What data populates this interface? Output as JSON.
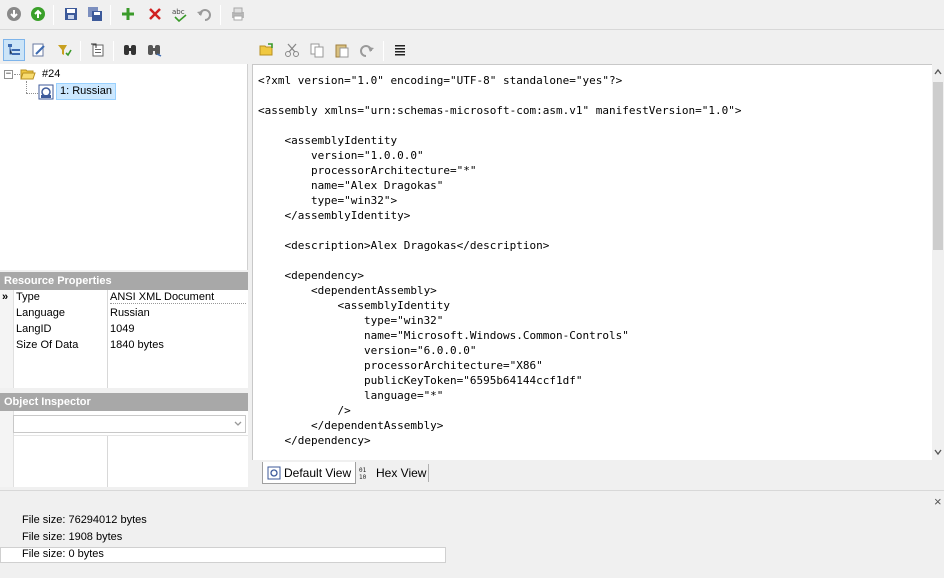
{
  "tree": {
    "root_label": "#24",
    "child_label": "1: Russian"
  },
  "resource_properties": {
    "header": "Resource Properties",
    "rows": [
      {
        "key": "Type",
        "value": "ANSI XML Document"
      },
      {
        "key": "Language",
        "value": "Russian"
      },
      {
        "key": "LangID",
        "value": "1049"
      },
      {
        "key": "Size Of Data",
        "value": "1840 bytes"
      }
    ],
    "current_marker": "»"
  },
  "object_inspector": {
    "header": "Object Inspector"
  },
  "editor": {
    "code": "<?xml version=\"1.0\" encoding=\"UTF-8\" standalone=\"yes\"?>\n\n<assembly xmlns=\"urn:schemas-microsoft-com:asm.v1\" manifestVersion=\"1.0\">\n\n    <assemblyIdentity\n        version=\"1.0.0.0\"\n        processorArchitecture=\"*\"\n        name=\"Alex Dragokas\"\n        type=\"win32\">\n    </assemblyIdentity>\n\n    <description>Alex Dragokas</description>\n\n    <dependency>\n        <dependentAssembly>\n            <assemblyIdentity\n                type=\"win32\"\n                name=\"Microsoft.Windows.Common-Controls\"\n                version=\"6.0.0.0\"\n                processorArchitecture=\"X86\"\n                publicKeyToken=\"6595b64144ccf1df\"\n                language=\"*\"\n            />\n        </dependentAssembly>\n    </dependency>"
  },
  "view_tabs": {
    "default_label": "Default View",
    "hex_label": "Hex View"
  },
  "log": {
    "lines": [
      "File size: 76294012 bytes",
      "File size: 1908 bytes",
      "File size: 0 bytes"
    ],
    "close_glyph": "×"
  },
  "icons": {
    "back": "back-icon",
    "forward": "forward-icon",
    "save": "save-icon",
    "save-all": "save-all-icon",
    "add": "add-icon",
    "delete": "delete-icon",
    "rename": "rename-icon",
    "undo": "undo-icon",
    "print": "print-icon",
    "tree-view": "tree-view-icon",
    "edit-resource": "edit-resource-icon",
    "filter": "filter-icon",
    "import": "import-icon",
    "find": "find-icon",
    "find-next": "find-next-icon",
    "open": "open-icon",
    "cut": "cut-icon",
    "copy": "copy-icon",
    "paste": "paste-icon",
    "redo": "redo-icon",
    "format": "format-icon"
  },
  "colors": {
    "accent_green": "#3a9a2a",
    "delete_red": "#d02020",
    "selection": "#cce8ff",
    "section_header": "#a8a8a8"
  }
}
